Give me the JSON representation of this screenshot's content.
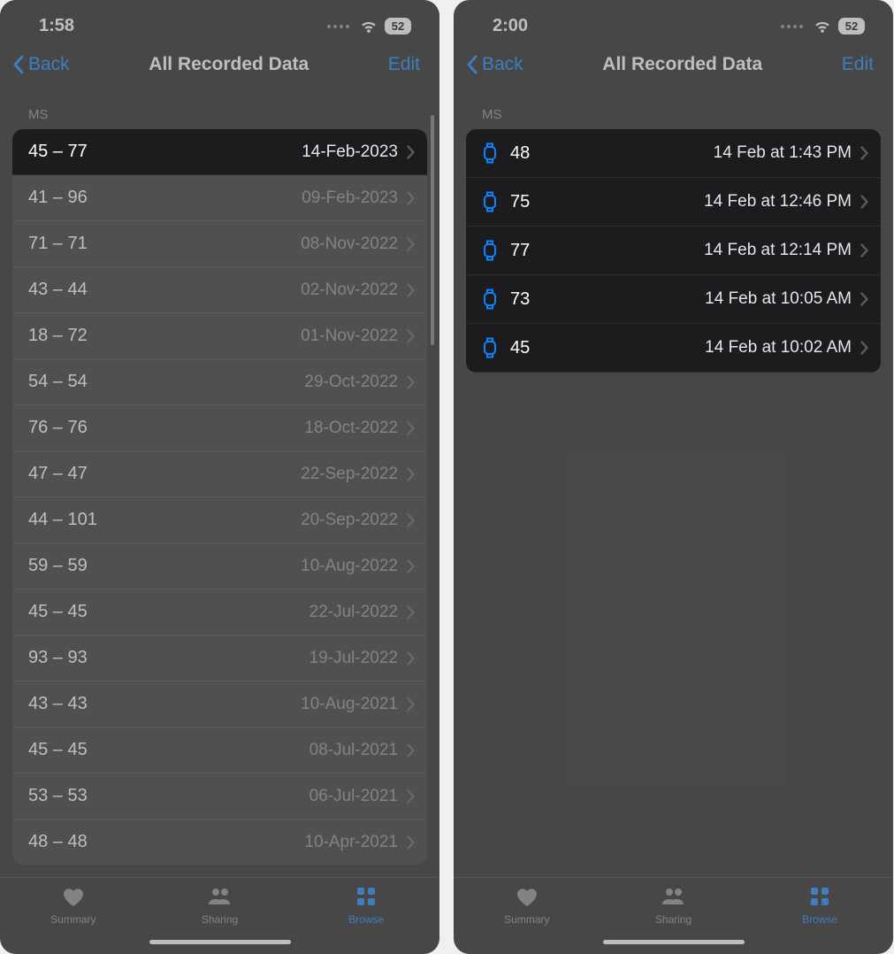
{
  "left": {
    "status": {
      "time": "1:58",
      "battery": "52"
    },
    "nav": {
      "back": "Back",
      "title": "All Recorded Data",
      "edit": "Edit"
    },
    "section_header": "MS",
    "rows": [
      {
        "value": "45 – 77",
        "date": "14-Feb-2023",
        "highlighted": true
      },
      {
        "value": "41 – 96",
        "date": "09-Feb-2023"
      },
      {
        "value": "71 – 71",
        "date": "08-Nov-2022"
      },
      {
        "value": "43 – 44",
        "date": "02-Nov-2022"
      },
      {
        "value": "18 – 72",
        "date": "01-Nov-2022"
      },
      {
        "value": "54 – 54",
        "date": "29-Oct-2022"
      },
      {
        "value": "76 – 76",
        "date": "18-Oct-2022"
      },
      {
        "value": "47 – 47",
        "date": "22-Sep-2022"
      },
      {
        "value": "44 – 101",
        "date": "20-Sep-2022"
      },
      {
        "value": "59 – 59",
        "date": "10-Aug-2022"
      },
      {
        "value": "45 – 45",
        "date": "22-Jul-2022"
      },
      {
        "value": "93 – 93",
        "date": "19-Jul-2022"
      },
      {
        "value": "43 – 43",
        "date": "10-Aug-2021"
      },
      {
        "value": "45 – 45",
        "date": "08-Jul-2021"
      },
      {
        "value": "53 – 53",
        "date": "06-Jul-2021"
      },
      {
        "value": "48 – 48",
        "date": "10-Apr-2021"
      }
    ],
    "tabs": {
      "summary": "Summary",
      "sharing": "Sharing",
      "browse": "Browse"
    }
  },
  "right": {
    "status": {
      "time": "2:00",
      "battery": "52"
    },
    "nav": {
      "back": "Back",
      "title": "All Recorded Data",
      "edit": "Edit"
    },
    "section_header": "MS",
    "rows": [
      {
        "value": "48",
        "date": "14 Feb at 1:43 PM"
      },
      {
        "value": "75",
        "date": "14 Feb at 12:46 PM"
      },
      {
        "value": "77",
        "date": "14 Feb at 12:14 PM"
      },
      {
        "value": "73",
        "date": "14 Feb at 10:05 AM"
      },
      {
        "value": "45",
        "date": "14 Feb at 10:02 AM"
      }
    ],
    "tabs": {
      "summary": "Summary",
      "sharing": "Sharing",
      "browse": "Browse"
    }
  }
}
